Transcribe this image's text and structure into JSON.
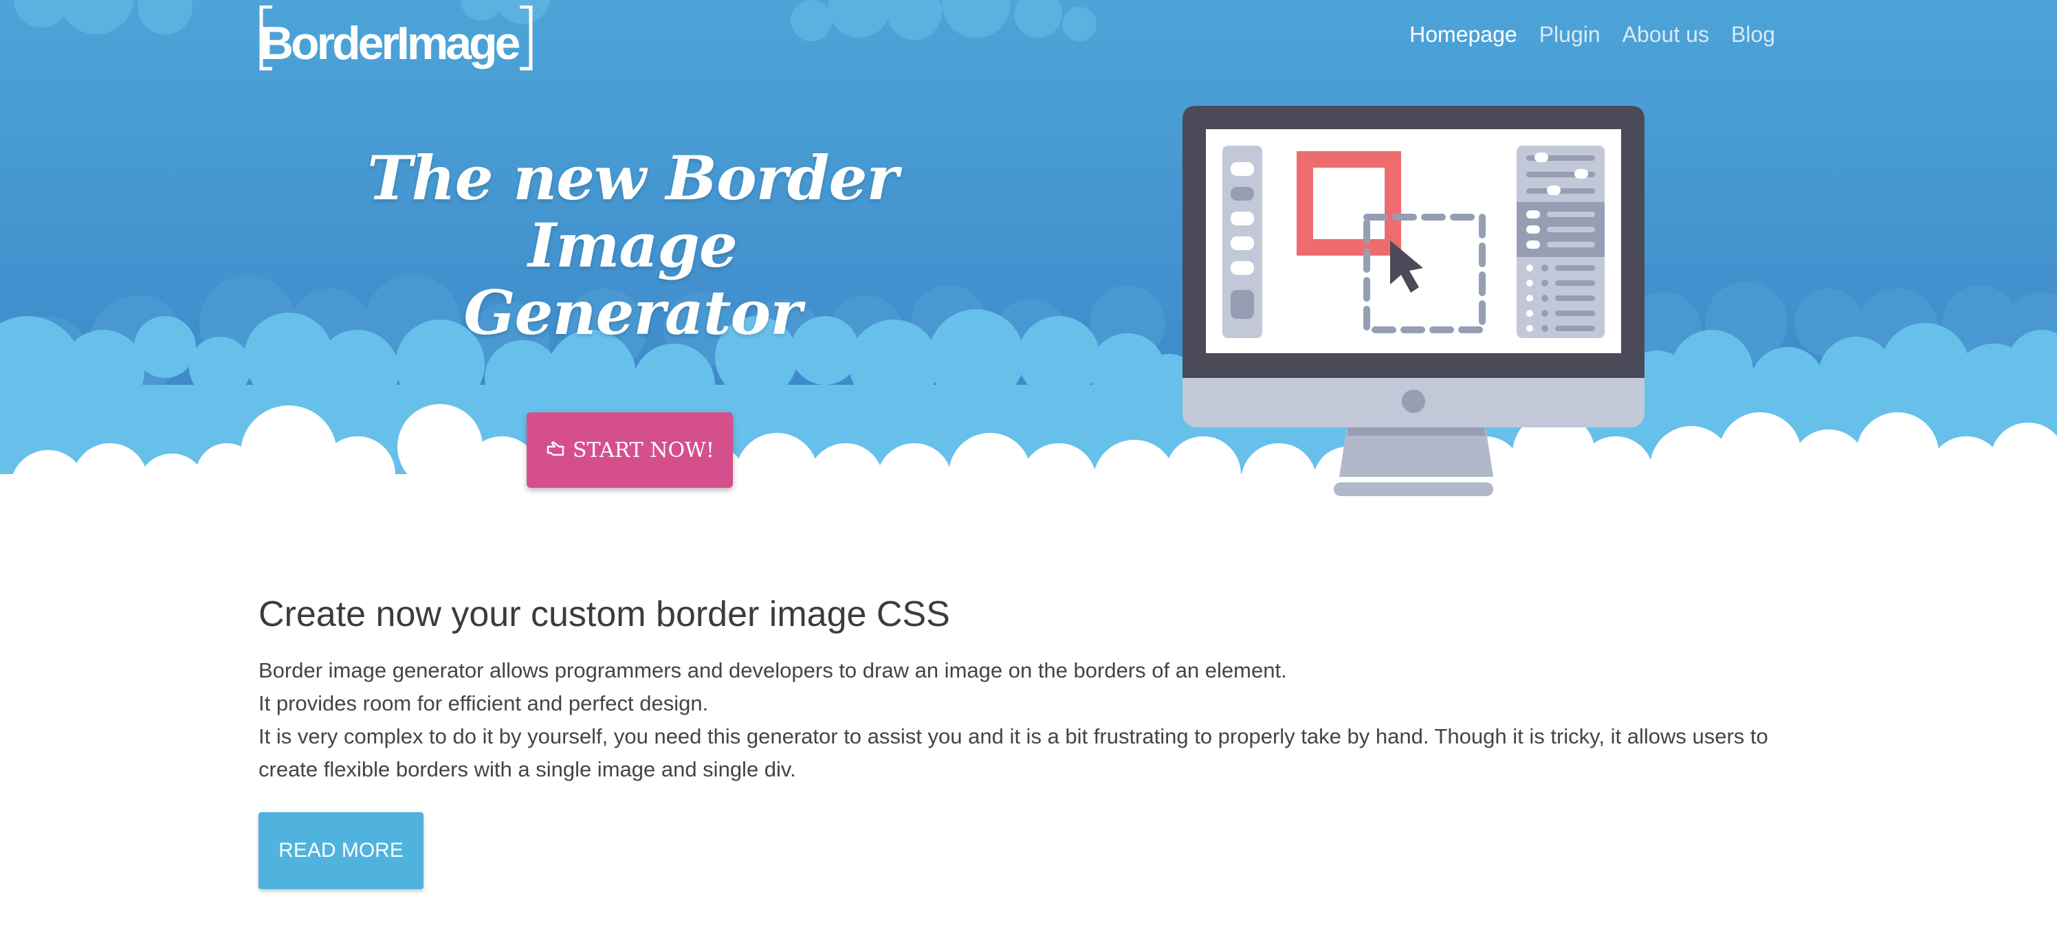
{
  "header": {
    "logo_text": "BorderImage",
    "nav": [
      {
        "label": "Homepage",
        "active": true
      },
      {
        "label": "Plugin",
        "active": false
      },
      {
        "label": "About us",
        "active": false
      },
      {
        "label": "Blog",
        "active": false
      }
    ]
  },
  "hero": {
    "title_line1": "The new Border Image",
    "title_line2": "Generator",
    "start_button_label": "START NOW!",
    "start_button_icon": "hand-point-icon"
  },
  "content": {
    "heading": "Create now your custom border image CSS",
    "paragraphs": [
      "Border image generator allows programmers and developers to draw an image on the borders of an element.",
      "It provides room for efficient and perfect design.",
      "It is very complex to do it by yourself, you need this generator to assist you and it is a bit frustrating to properly take by hand. Though it is tricky, it allows users to create flexible borders with a single image and single div."
    ],
    "read_more_label": "READ MORE"
  },
  "colors": {
    "sky_top": "#4da4d8",
    "sky_bottom": "#3c86c9",
    "start_button": "#d64f8d",
    "read_more_button": "#4fb3dd",
    "illustration_red": "#ee6b6e",
    "monitor_frame": "#4a4a58"
  }
}
